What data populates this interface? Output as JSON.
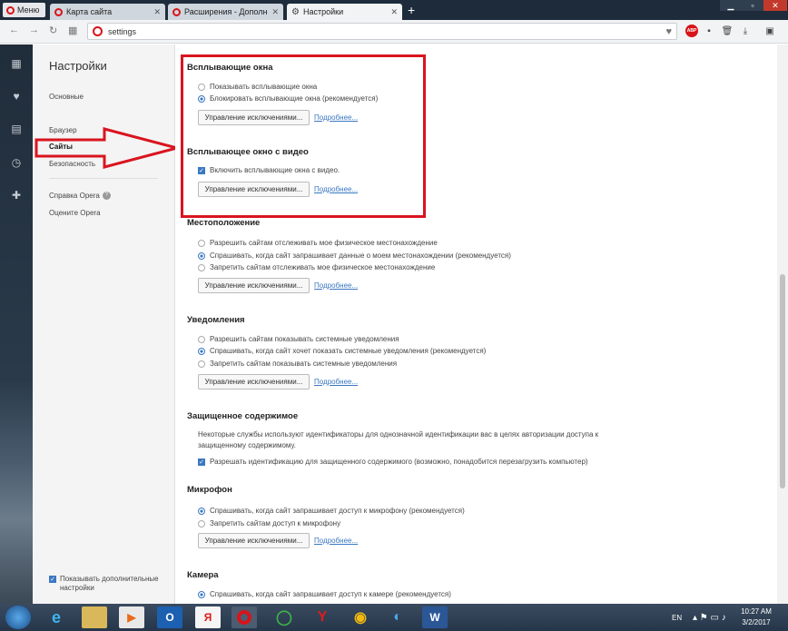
{
  "browser": {
    "menu_label": "Меню",
    "tabs": [
      {
        "label": "Карта сайта"
      },
      {
        "label": "Расширения - Дополне"
      },
      {
        "label": "Настройки"
      }
    ],
    "new_tab": "+",
    "url": "settings"
  },
  "nav": {
    "title": "Настройки",
    "items": [
      {
        "label": "Основные"
      },
      {
        "label": "Браузер"
      },
      {
        "label": "Сайты"
      },
      {
        "label": "Безопасность"
      }
    ],
    "help_label": "Справка Opera",
    "rate_label": "Оцените Opera",
    "show_advanced": "Показывать дополнительные настройки"
  },
  "sections": {
    "popups": {
      "title": "Всплывающие окна",
      "options": [
        "Показывать всплывающие окна",
        "Блокировать всплывающие окна (рекомендуется)"
      ],
      "manage": "Управление исключениями...",
      "more": "Подробнее..."
    },
    "video_popup": {
      "title": "Всплывающее окно с видео",
      "checkbox": "Включить всплывающие окна с видео.",
      "manage": "Управление исключениями...",
      "more": "Подробнее..."
    },
    "location": {
      "title": "Местоположение",
      "options": [
        "Разрешить сайтам отслеживать мое физическое местонахождение",
        "Спрашивать, когда сайт запрашивает данные о моем местонахождении (рекомендуется)",
        "Запретить сайтам отслеживать мое физическое местонахождение"
      ],
      "manage": "Управление исключениями...",
      "more": "Подробнее..."
    },
    "notifications": {
      "title": "Уведомления",
      "options": [
        "Разрешить сайтам показывать системные уведомления",
        "Спрашивать, когда сайт хочет показать системные уведомления (рекомендуется)",
        "Запретить сайтам показывать системные уведомления"
      ],
      "manage": "Управление исключениями...",
      "more": "Подробнее..."
    },
    "protected": {
      "title": "Защищенное содержимое",
      "description": "Некоторые службы используют идентификаторы для однозначной идентификации вас в целях авторизации доступа к защищенному содержимому.",
      "checkbox": "Разрешать идентификацию для защищенного содержимого (возможно, понадобится перезагрузить компьютер)"
    },
    "microphone": {
      "title": "Микрофон",
      "options": [
        "Спрашивать, когда сайт запрашивает доступ к микрофону (рекомендуется)",
        "Запретить сайтам доступ к микрофону"
      ],
      "manage": "Управление исключениями...",
      "more": "Подробнее..."
    },
    "camera": {
      "title": "Камера",
      "options": [
        "Спрашивать, когда сайт запрашивает доступ к камере (рекомендуется)"
      ]
    }
  },
  "taskbar": {
    "lang": "EN",
    "time": "10:27 AM",
    "date": "3/2/2017"
  },
  "colors": {
    "accent": "#3a78c2",
    "highlight_red": "#d9141f",
    "opera_red": "#d7141a"
  }
}
